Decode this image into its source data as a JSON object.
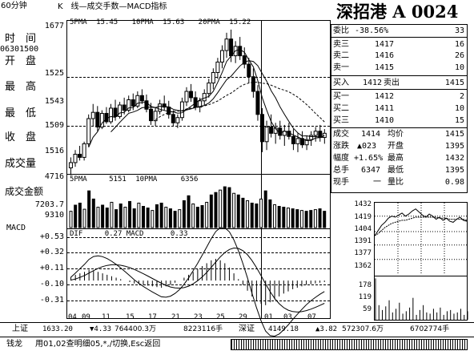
{
  "window": {
    "period": "60分钟",
    "indicator_title": "K　线—成交手数—MACD指标",
    "stock_title": "深招港 A 0024"
  },
  "ma_line": {
    "l1": "5PMA",
    "v1": "15.45",
    "l2": "10PMA",
    "v2": "15.63",
    "l3": "20PMA",
    "v3": "15.22"
  },
  "vol_line": {
    "l1": "5PMA",
    "v1": "5151",
    "l2": "10PMA",
    "v2": "6356"
  },
  "macd_line": {
    "l1": "DIF",
    "v1": "0.27",
    "l2": "MACD",
    "v2": "0.33"
  },
  "left_panel": {
    "top_value": "1677",
    "time_label": "时　间",
    "time_value": "06301500",
    "open_label": "开　盘",
    "open_value": "1525",
    "high_label": "最　高",
    "high_value": "1543",
    "low_label": "最　低",
    "low_value": "1509",
    "close_label": "收　盘",
    "close_value": "1516",
    "vol_label": "成交量",
    "vol_value": "4716",
    "amount_label": "成交金额",
    "amount_value": "7203.7",
    "vol_axis_value": "9310",
    "macd_label": "MACD"
  },
  "macd_axis": [
    "+0.53",
    "+0.32",
    "+0.11",
    "-0.10",
    "-0.31"
  ],
  "x_axis": [
    "04",
    "09",
    "11",
    "15",
    "17",
    "21",
    "23",
    "25",
    "29",
    "01",
    "03",
    "07"
  ],
  "order_book": {
    "weibi_label": "委比",
    "weibi_value": "-38.56%",
    "weibi_diff": "33",
    "asks": [
      {
        "label": "卖三",
        "price": "1417",
        "qty": "16"
      },
      {
        "label": "卖二",
        "price": "1416",
        "qty": "26"
      },
      {
        "label": "卖一",
        "price": "1415",
        "qty": "10"
      }
    ],
    "buy_in_label": "买入",
    "buy_in_price": "1412",
    "sell_out_label": "卖出",
    "sell_out_price": "1415",
    "bids": [
      {
        "label": "买一",
        "price": "1412",
        "qty": "2"
      },
      {
        "label": "买二",
        "price": "1411",
        "qty": "10"
      },
      {
        "label": "买三",
        "price": "1410",
        "qty": "15"
      }
    ]
  },
  "stats": [
    {
      "l1": "成交",
      "v1": "1414",
      "l2": "均价",
      "v2": "1415"
    },
    {
      "l1": "涨跌",
      "v1": "▲023",
      "l2": "开盘",
      "v2": "1395"
    },
    {
      "l1": "幅度",
      "v1": "+1.65%",
      "l2": "最高",
      "v2": "1432"
    },
    {
      "l1": "总手",
      "v1": "6347",
      "l2": "最低",
      "v2": "1395"
    },
    {
      "l1": "现手",
      "v1": "一",
      "l2": "量比",
      "v2": "0.98"
    }
  ],
  "mini_chart": {
    "price_ticks": [
      "1432",
      "1419",
      "1404",
      "1391",
      "1377",
      "1362"
    ],
    "vol_ticks": [
      "178",
      "119",
      "59"
    ],
    "intraday_prices": [
      1400,
      1405,
      1410,
      1413,
      1417,
      1419,
      1418,
      1420,
      1422,
      1419,
      1421,
      1424,
      1426,
      1423,
      1420,
      1418,
      1421,
      1419,
      1416,
      1418,
      1415,
      1417,
      1414,
      1413,
      1416,
      1418,
      1415,
      1414
    ],
    "intraday_avg": [
      1400,
      1402,
      1405,
      1408,
      1410,
      1412,
      1413,
      1414,
      1415,
      1415,
      1416,
      1417,
      1418,
      1418,
      1418,
      1418,
      1418,
      1418,
      1418,
      1417,
      1417,
      1417,
      1416,
      1416,
      1416,
      1416,
      1416,
      1415
    ],
    "intraday_volumes": [
      170,
      60,
      40,
      55,
      80,
      30,
      45,
      70,
      25,
      35,
      50,
      90,
      20,
      40,
      60,
      30,
      25,
      45,
      30,
      50,
      20,
      35,
      40,
      25,
      30,
      45,
      20,
      35
    ]
  },
  "bottom": {
    "idx1_label": "上证",
    "idx1_value": "1633.20",
    "idx1_change": "▼4.33",
    "idx1_amount": "764400.3万",
    "idx1_vol": "8223116手",
    "idx2_label": "深证",
    "idx2_value": "4149.18",
    "idx2_change": "▲3.82",
    "idx2_amount": "572307.6万",
    "idx2_vol": "6702774手",
    "status_app": "钱龙",
    "status_hint": "用01,02查明细05,*,/切换,Esc返回"
  },
  "chart_data": {
    "type": "candlestick",
    "title": "K　线—成交手数—MACD指标",
    "x_tick_labels": [
      "04",
      "09",
      "11",
      "15",
      "17",
      "21",
      "23",
      "25",
      "29",
      "01",
      "03",
      "07"
    ],
    "ylim": [
      1509,
      1677
    ],
    "price_ticks": [
      1677,
      1525,
      1543,
      1509,
      1516
    ],
    "candles": [
      {
        "o": 1545,
        "h": 1555,
        "l": 1538,
        "c": 1550
      },
      {
        "o": 1550,
        "h": 1562,
        "l": 1546,
        "c": 1558
      },
      {
        "o": 1558,
        "h": 1566,
        "l": 1552,
        "c": 1555
      },
      {
        "o": 1555,
        "h": 1570,
        "l": 1552,
        "c": 1568
      },
      {
        "o": 1568,
        "h": 1596,
        "l": 1565,
        "c": 1592
      },
      {
        "o": 1592,
        "h": 1606,
        "l": 1585,
        "c": 1598
      },
      {
        "o": 1598,
        "h": 1604,
        "l": 1580,
        "c": 1584
      },
      {
        "o": 1584,
        "h": 1600,
        "l": 1582,
        "c": 1597
      },
      {
        "o": 1597,
        "h": 1603,
        "l": 1587,
        "c": 1589
      },
      {
        "o": 1589,
        "h": 1606,
        "l": 1587,
        "c": 1602
      },
      {
        "o": 1602,
        "h": 1610,
        "l": 1590,
        "c": 1594
      },
      {
        "o": 1594,
        "h": 1608,
        "l": 1592,
        "c": 1605
      },
      {
        "o": 1605,
        "h": 1612,
        "l": 1596,
        "c": 1600
      },
      {
        "o": 1600,
        "h": 1614,
        "l": 1598,
        "c": 1610
      },
      {
        "o": 1610,
        "h": 1616,
        "l": 1600,
        "c": 1604
      },
      {
        "o": 1604,
        "h": 1618,
        "l": 1602,
        "c": 1614
      },
      {
        "o": 1614,
        "h": 1620,
        "l": 1606,
        "c": 1609
      },
      {
        "o": 1609,
        "h": 1615,
        "l": 1598,
        "c": 1601
      },
      {
        "o": 1601,
        "h": 1607,
        "l": 1586,
        "c": 1590
      },
      {
        "o": 1590,
        "h": 1603,
        "l": 1585,
        "c": 1599
      },
      {
        "o": 1599,
        "h": 1610,
        "l": 1596,
        "c": 1606
      },
      {
        "o": 1606,
        "h": 1614,
        "l": 1600,
        "c": 1603
      },
      {
        "o": 1603,
        "h": 1609,
        "l": 1592,
        "c": 1596
      },
      {
        "o": 1596,
        "h": 1600,
        "l": 1585,
        "c": 1588
      },
      {
        "o": 1588,
        "h": 1596,
        "l": 1583,
        "c": 1593
      },
      {
        "o": 1593,
        "h": 1612,
        "l": 1590,
        "c": 1608
      },
      {
        "o": 1608,
        "h": 1622,
        "l": 1604,
        "c": 1618
      },
      {
        "o": 1618,
        "h": 1625,
        "l": 1608,
        "c": 1612
      },
      {
        "o": 1612,
        "h": 1618,
        "l": 1600,
        "c": 1603
      },
      {
        "o": 1603,
        "h": 1612,
        "l": 1598,
        "c": 1609
      },
      {
        "o": 1609,
        "h": 1620,
        "l": 1605,
        "c": 1616
      },
      {
        "o": 1616,
        "h": 1630,
        "l": 1612,
        "c": 1626
      },
      {
        "o": 1626,
        "h": 1640,
        "l": 1620,
        "c": 1636
      },
      {
        "o": 1636,
        "h": 1650,
        "l": 1630,
        "c": 1646
      },
      {
        "o": 1646,
        "h": 1662,
        "l": 1640,
        "c": 1657
      },
      {
        "o": 1657,
        "h": 1674,
        "l": 1650,
        "c": 1668
      },
      {
        "o": 1668,
        "h": 1677,
        "l": 1646,
        "c": 1652
      },
      {
        "o": 1652,
        "h": 1666,
        "l": 1645,
        "c": 1661
      },
      {
        "o": 1661,
        "h": 1670,
        "l": 1648,
        "c": 1652
      },
      {
        "o": 1652,
        "h": 1660,
        "l": 1640,
        "c": 1644
      },
      {
        "o": 1644,
        "h": 1650,
        "l": 1626,
        "c": 1632
      },
      {
        "o": 1632,
        "h": 1640,
        "l": 1612,
        "c": 1618
      },
      {
        "o": 1618,
        "h": 1624,
        "l": 1590,
        "c": 1596
      },
      {
        "o": 1596,
        "h": 1602,
        "l": 1560,
        "c": 1570
      },
      {
        "o": 1570,
        "h": 1590,
        "l": 1562,
        "c": 1584
      },
      {
        "o": 1584,
        "h": 1596,
        "l": 1574,
        "c": 1578
      },
      {
        "o": 1578,
        "h": 1588,
        "l": 1568,
        "c": 1583
      },
      {
        "o": 1583,
        "h": 1590,
        "l": 1572,
        "c": 1576
      },
      {
        "o": 1576,
        "h": 1586,
        "l": 1566,
        "c": 1580
      },
      {
        "o": 1580,
        "h": 1588,
        "l": 1572,
        "c": 1575
      },
      {
        "o": 1575,
        "h": 1582,
        "l": 1562,
        "c": 1568
      },
      {
        "o": 1568,
        "h": 1578,
        "l": 1560,
        "c": 1573
      },
      {
        "o": 1573,
        "h": 1580,
        "l": 1564,
        "c": 1567
      },
      {
        "o": 1567,
        "h": 1576,
        "l": 1562,
        "c": 1572
      },
      {
        "o": 1572,
        "h": 1580,
        "l": 1566,
        "c": 1576
      },
      {
        "o": 1576,
        "h": 1584,
        "l": 1570,
        "c": 1580
      },
      {
        "o": 1580,
        "h": 1586,
        "l": 1570,
        "c": 1574
      },
      {
        "o": 1574,
        "h": 1582,
        "l": 1568,
        "c": 1578
      }
    ],
    "volumes": [
      40,
      55,
      60,
      45,
      90,
      70,
      50,
      55,
      48,
      62,
      44,
      58,
      50,
      64,
      46,
      60,
      52,
      48,
      42,
      56,
      60,
      50,
      46,
      40,
      44,
      66,
      78,
      58,
      50,
      54,
      62,
      80,
      86,
      92,
      100,
      98,
      84,
      80,
      72,
      66,
      60,
      58,
      70,
      90,
      68,
      56,
      52,
      50,
      48,
      46,
      44,
      42,
      40,
      42,
      44,
      46,
      40
    ],
    "macd_hist": [
      0.05,
      0.08,
      0.1,
      0.12,
      0.15,
      0.14,
      0.12,
      0.1,
      0.08,
      0.06,
      0.04,
      0.02,
      0.0,
      -0.02,
      -0.04,
      -0.05,
      -0.06,
      -0.07,
      -0.08,
      -0.09,
      -0.1,
      -0.08,
      -0.06,
      -0.03,
      0.0,
      0.04,
      0.08,
      0.12,
      0.16,
      0.2,
      0.24,
      0.28,
      0.3,
      0.28,
      0.24,
      0.18,
      0.1,
      0.02,
      -0.06,
      -0.14,
      -0.22,
      -0.28,
      -0.32,
      -0.34,
      -0.3,
      -0.26,
      -0.22,
      -0.18,
      -0.15,
      -0.12,
      -0.1,
      -0.08,
      -0.06,
      -0.05,
      -0.04,
      -0.03,
      -0.02
    ],
    "macd_ylim": [
      -0.42,
      0.6
    ]
  }
}
